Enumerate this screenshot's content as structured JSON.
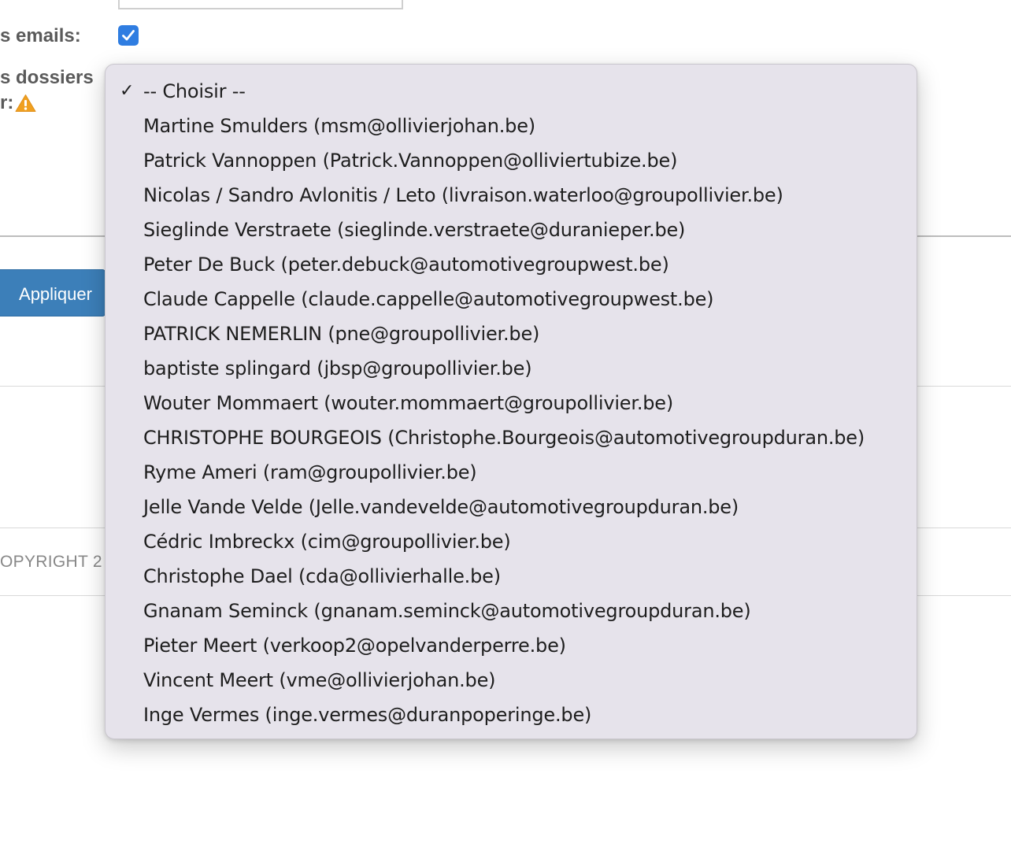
{
  "form": {
    "emails_label": "s emails:",
    "emails_checked": true,
    "dossiers_label": "s dossiers",
    "dossiers_label_cont": "r:",
    "apply_label": "Appliquer",
    "copyright": "OPYRIGHT 2"
  },
  "dropdown": {
    "selected_index": 0,
    "check_glyph": "✓",
    "options": [
      "-- Choisir --",
      "Martine Smulders (msm@ollivierjohan.be)",
      "Patrick Vannoppen (Patrick.Vannoppen@olliviertubize.be)",
      "Nicolas / Sandro Avlonitis / Leto (livraison.waterloo@groupollivier.be)",
      "Sieglinde Verstraete (sieglinde.verstraete@duranieper.be)",
      "Peter De Buck (peter.debuck@automotivegroupwest.be)",
      "Claude Cappelle (claude.cappelle@automotivegroupwest.be)",
      "PATRICK NEMERLIN (pne@groupollivier.be)",
      "baptiste splingard (jbsp@groupollivier.be)",
      "Wouter Mommaert (wouter.mommaert@groupollivier.be)",
      "CHRISTOPHE BOURGEOIS (Christophe.Bourgeois@automotivegroupduran.be)",
      "Ryme Ameri (ram@groupollivier.be)",
      "Jelle Vande Velde (Jelle.vandevelde@automotivegroupduran.be)",
      "Cédric Imbreckx (cim@groupollivier.be)",
      "Christophe Dael (cda@ollivierhalle.be)",
      "Gnanam Seminck (gnanam.seminck@automotivegroupduran.be)",
      "Pieter Meert (verkoop2@opelvanderperre.be)",
      "Vincent Meert (vme@ollivierjohan.be)",
      "Inge Vermes (inge.vermes@duranpoperinge.be)"
    ]
  },
  "colors": {
    "checkbox": "#2f7de1",
    "button": "#3c7fb9",
    "warning": "#f0a020",
    "dropdown_bg": "#e6e3eb"
  },
  "icons": {
    "warning": "warning-icon",
    "checkmark": "checkmark-icon"
  }
}
